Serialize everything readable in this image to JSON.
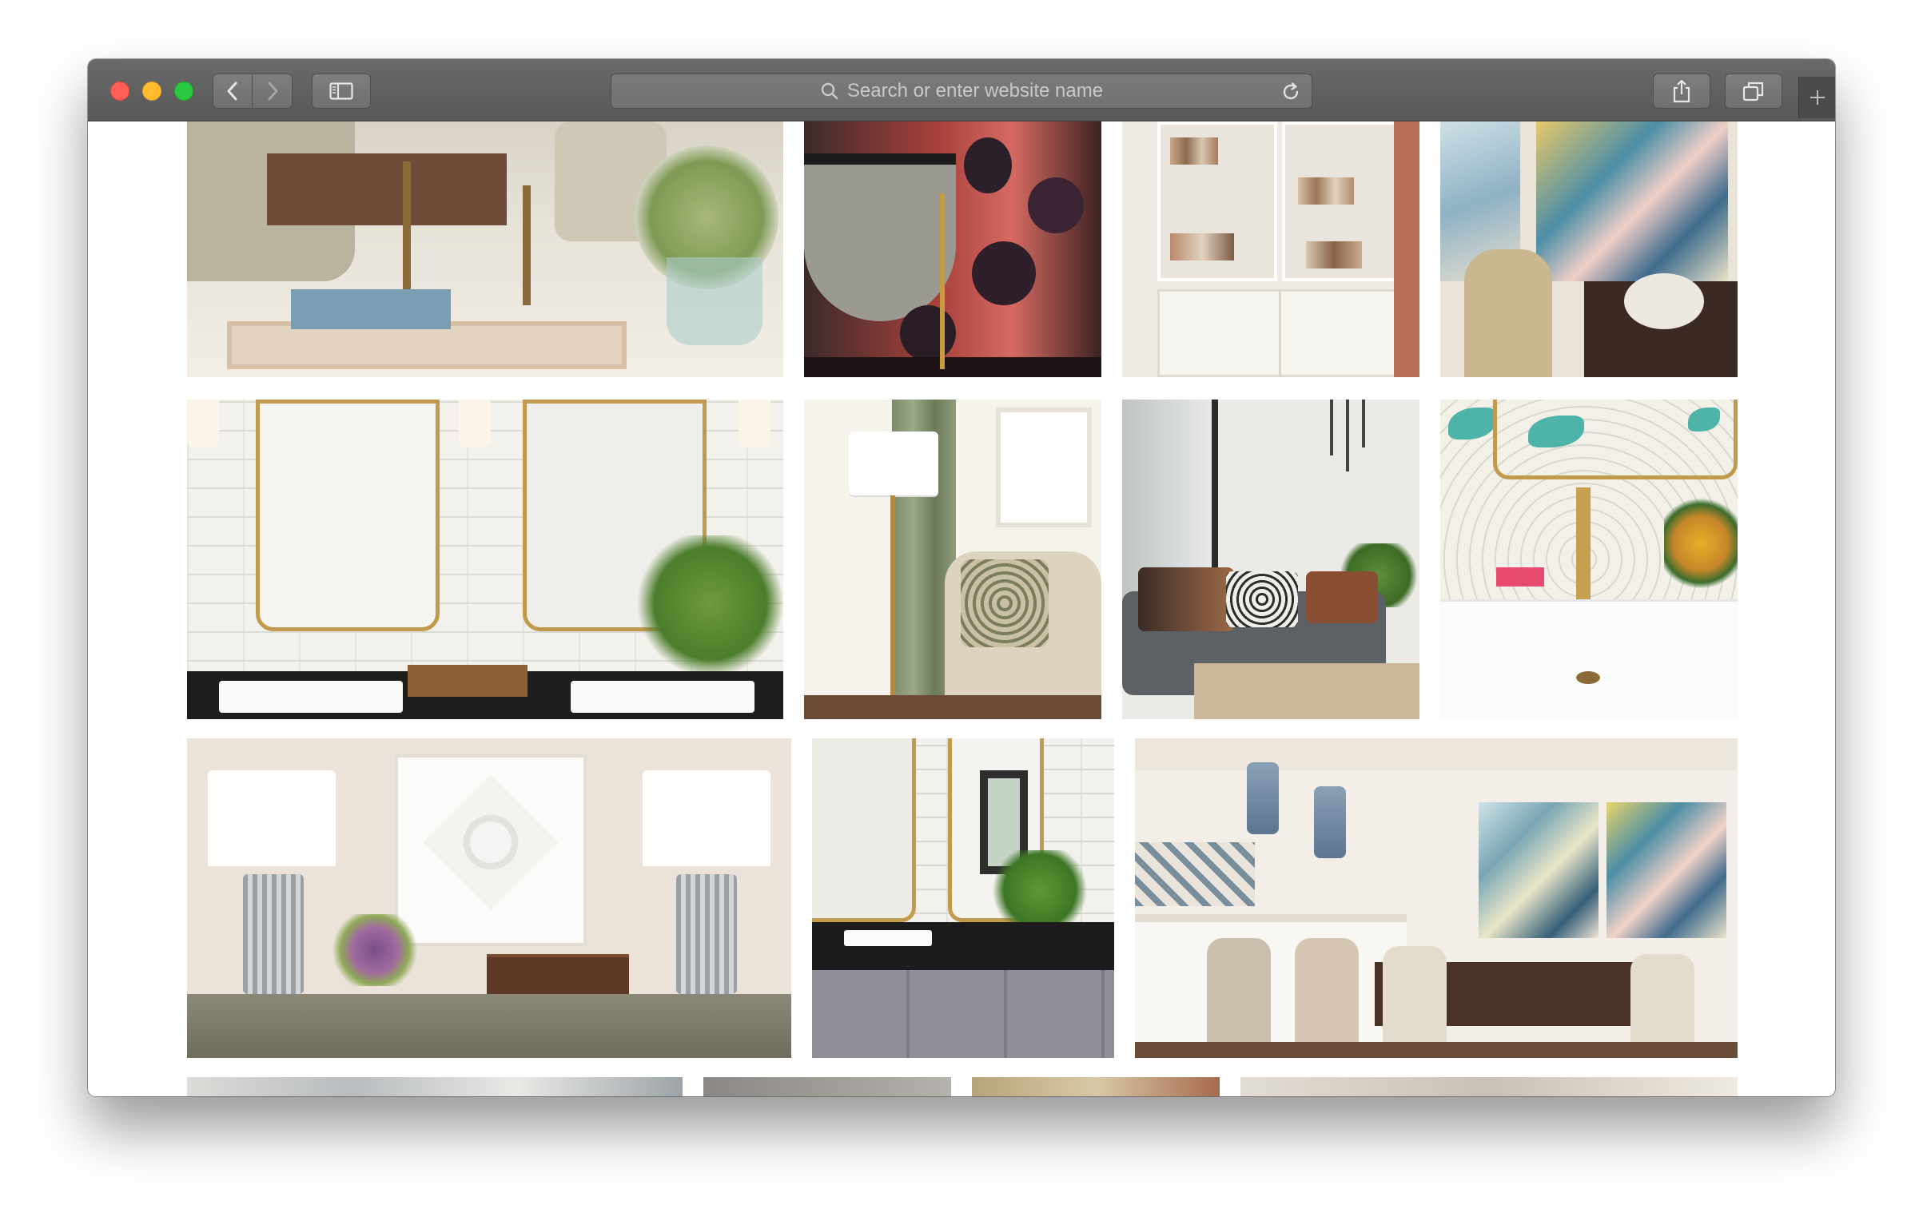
{
  "browser": {
    "url_placeholder": "Search or enter website name",
    "icons": {
      "back": "chevron-left-icon",
      "forward": "chevron-right-icon",
      "sidebar": "sidebar-icon",
      "search": "search-icon",
      "reload": "reload-icon",
      "share": "share-icon",
      "tabs": "tabs-overview-icon",
      "new_tab": "plus-icon"
    },
    "colors": {
      "close": "#fe5f57",
      "minimize": "#febc2e",
      "maximize": "#28c840",
      "toolbar": "#606060"
    }
  },
  "gallery": {
    "images": [
      {
        "subject": "living-room-coffee-table"
      },
      {
        "subject": "powder-room-vanity"
      },
      {
        "subject": "white-bookshelves"
      },
      {
        "subject": "abstract-art-dining"
      },
      {
        "subject": "double-vanity-bathroom"
      },
      {
        "subject": "armchair-floor-lamp"
      },
      {
        "subject": "gray-sofa-living-room"
      },
      {
        "subject": "bird-wallpaper-sink"
      },
      {
        "subject": "console-table-lamps"
      },
      {
        "subject": "bathroom-vanity-window"
      },
      {
        "subject": "kitchen-dining-room"
      },
      {
        "subject": "partial-image-1"
      },
      {
        "subject": "partial-image-2"
      },
      {
        "subject": "partial-image-3"
      },
      {
        "subject": "partial-image-4"
      }
    ]
  }
}
